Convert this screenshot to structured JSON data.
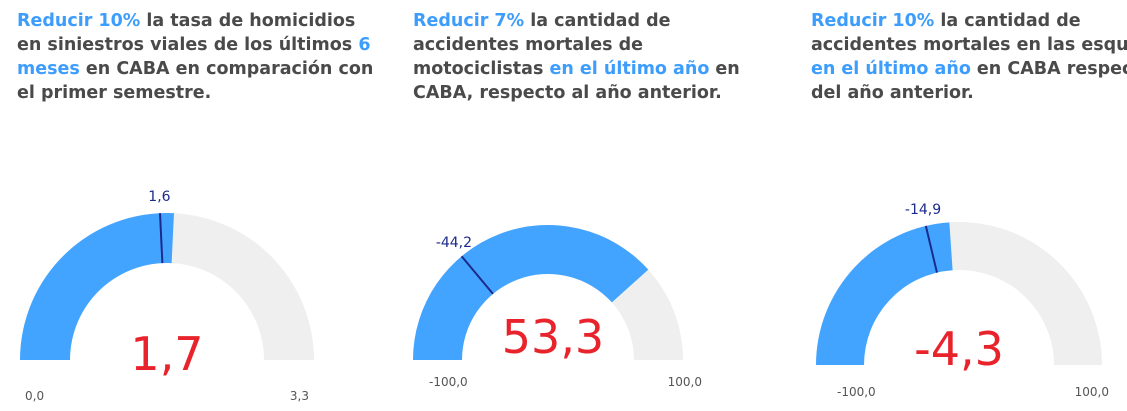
{
  "colors": {
    "headline_text": "#4a4a4a",
    "highlight": "#3d9dfc",
    "gauge_fill": "#43a4ff",
    "gauge_track": "#efefef",
    "target_line": "#1c2a8c",
    "target_label": "#1c2a8c",
    "value_text": "#e8232b",
    "axis_text": "#555555"
  },
  "panels": [
    {
      "headline": {
        "highlight1": "Reducir 10%",
        "text1": " la tasa de homicidios en siniestros viales de los últimos ",
        "highlight2": "6 meses",
        "text2": " en CABA en comparación con el primer semestre."
      }
    },
    {
      "headline": {
        "highlight1": "Reducir 7%",
        "text1": " la cantidad de accidentes mortales de motociclistas ",
        "highlight2": "en el último año",
        "text2": " en CABA, respecto al año anterior."
      }
    },
    {
      "headline": {
        "highlight1": "Reducir 10%",
        "text1": " la cantidad de accidentes mortales en las esquinas ",
        "highlight2": "en el último año",
        "text2": " en CABA respecto del año anterior."
      }
    }
  ],
  "chart_data": [
    {
      "type": "gauge",
      "min": 0.0,
      "max": 3.3,
      "value": 1.7,
      "target": 1.6,
      "min_label": "0,0",
      "max_label": "3,3",
      "value_label": "1,7",
      "target_label": "1,6"
    },
    {
      "type": "gauge",
      "min": -100.0,
      "max": 100.0,
      "value": 53.3,
      "target": -44.2,
      "min_label": "-100,0",
      "max_label": "100,0",
      "value_label": "53,3",
      "target_label": "-44,2"
    },
    {
      "type": "gauge",
      "min": -100.0,
      "max": 100.0,
      "value": -4.3,
      "target": -14.9,
      "min_label": "-100,0",
      "max_label": "100,0",
      "value_label": "-4,3",
      "target_label": "-14,9"
    }
  ]
}
